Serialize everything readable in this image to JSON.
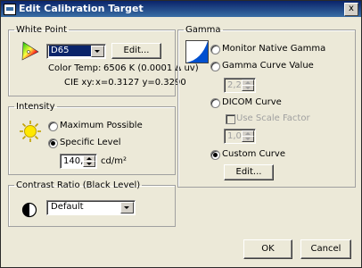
{
  "window": {
    "title": "Edit Calibration Target",
    "close_label": "x"
  },
  "white_point": {
    "group_label": "White Point",
    "selected": "D65",
    "edit_label": "Edit...",
    "color_temp_label": "Color Temp:",
    "color_temp_value": "6506 K (0.0001 Δ uv)",
    "cie_label": "CIE xy:",
    "cie_value": "x=0.3127 y=0.3290"
  },
  "intensity": {
    "group_label": "Intensity",
    "options": [
      "Maximum Possible",
      "Specific Level"
    ],
    "selected_index": 1,
    "level_value": "140,0",
    "unit": "cd/m²"
  },
  "contrast": {
    "group_label": "Contrast Ratio (Black Level)",
    "selected": "Default"
  },
  "gamma": {
    "group_label": "Gamma",
    "options": [
      "Monitor Native Gamma",
      "Gamma Curve Value",
      "DICOM Curve",
      "Custom Curve"
    ],
    "selected_index": 3,
    "gamma_value": "2,20",
    "use_scale_factor_label": "Use Scale Factor",
    "scale_factor_value": "1,00",
    "edit_label": "Edit..."
  },
  "buttons": {
    "ok": "OK",
    "cancel": "Cancel"
  },
  "icons": {
    "white_point": "cie-chromaticity-icon",
    "intensity": "sun-brightness-icon",
    "contrast": "half-circle-contrast-icon",
    "gamma": "gamma-curve-icon"
  },
  "colors": {
    "title_bar": "#0a246a",
    "selection": "#0a246a",
    "dialog_bg": "#ece9d8"
  }
}
